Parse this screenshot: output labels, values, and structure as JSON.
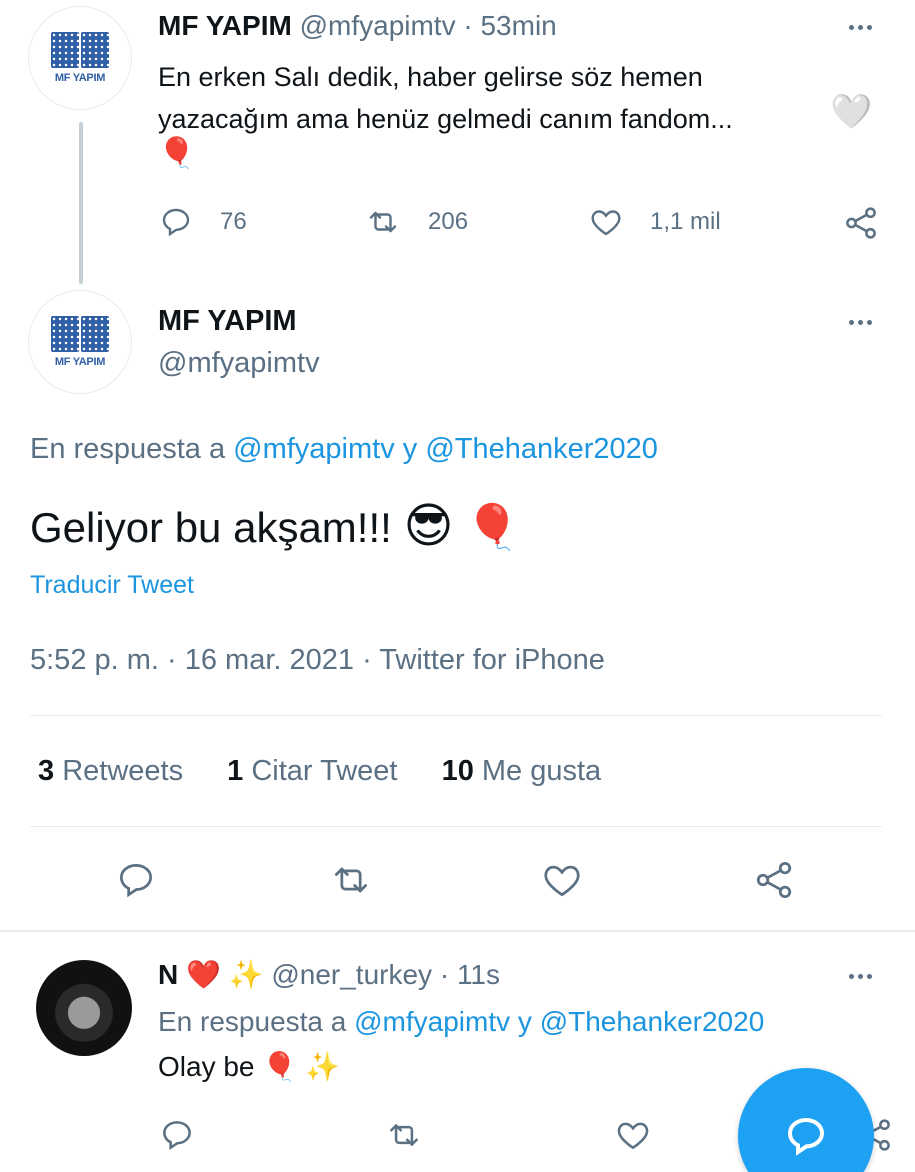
{
  "colors": {
    "accent": "#1da1f2",
    "link": "#1b95e0",
    "muted": "#5b7083",
    "heart": "#e0245e"
  },
  "tweet1": {
    "avatar_caption": "MF YAPIM",
    "name": "MF YAPIM",
    "handle": "@mfyapimtv",
    "sep": "·",
    "time": "53min",
    "text_line1": "En erken Salı dedik, haber gelirse söz hemen",
    "text_line2": "yazacağım ama henüz gelmedi canım fandom...",
    "emoji_heart": "🤍",
    "emoji_balloon": "🎈",
    "replies": "76",
    "retweets": "206",
    "likes": "1,1 mil"
  },
  "main_tweet": {
    "avatar_caption": "MF YAPIM",
    "name": "MF YAPIM",
    "handle": "@mfyapimtv",
    "reply_prefix": "En respuesta a",
    "reply_user1": "@mfyapimtv",
    "reply_y": "y",
    "reply_user2": "@Thehanker2020",
    "text": "Geliyor bu akşam!!!",
    "emoji_sunglasses": "😎",
    "emoji_balloon": "🎈",
    "translate": "Traducir Tweet",
    "meta": "5:52 p. m. · 16 mar. 2021 · Twitter for iPhone",
    "stats": {
      "retweets_count": "3",
      "retweets_label": "Retweets",
      "quotes_count": "1",
      "quotes_label": "Citar Tweet",
      "likes_count": "10",
      "likes_label": "Me gusta"
    }
  },
  "reply": {
    "name": "N",
    "emoji_heart": "❤️",
    "emoji_sparkles": "✨",
    "handle": "@ner_turkey",
    "sep": "·",
    "time": "11s",
    "reply_prefix": "En respuesta a",
    "reply_user1": "@mfyapimtv",
    "reply_y": "y",
    "reply_user2": "@Thehanker2020",
    "text": "Olay be",
    "emoji_balloon": "🎈",
    "emoji_sparkles2": "✨"
  },
  "icons": {
    "reply": "reply-icon",
    "retweet": "retweet-icon",
    "like": "heart-icon",
    "share": "share-icon",
    "more": "more-dots-icon",
    "compose": "compose-reply-icon"
  }
}
